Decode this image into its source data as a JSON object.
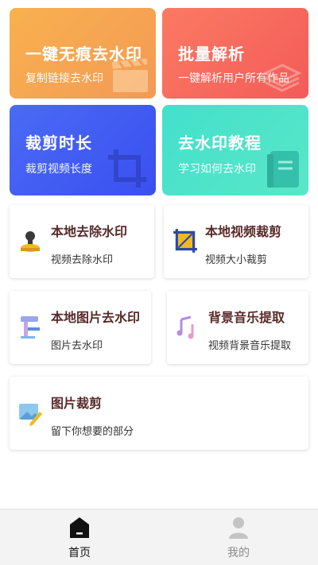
{
  "feature_cards": [
    {
      "title": "一键无痕去水印",
      "subtitle": "复制链接去水印",
      "icon": "clapperboard-icon",
      "colors": [
        "#f9b14f",
        "#f39a55"
      ]
    },
    {
      "title": "批量解析",
      "subtitle": "一键解析用户所有作品",
      "icon": "layers-icon",
      "colors": [
        "#fb7a63",
        "#f35b58"
      ]
    },
    {
      "title": "裁剪时长",
      "subtitle": "裁剪视频长度",
      "icon": "crop-icon",
      "colors": [
        "#4a6bf5",
        "#3a4ff0"
      ]
    },
    {
      "title": "去水印教程",
      "subtitle": "学习如何去水印",
      "icon": "book-icon",
      "colors": [
        "#43e0cc",
        "#59e7c8"
      ]
    }
  ],
  "tool_cards": [
    {
      "title": "本地去除水印",
      "subtitle": "视频去除水印",
      "icon": "stamp-icon"
    },
    {
      "title": "本地视频裁剪",
      "subtitle": "视频大小裁剪",
      "icon": "crop-frame-icon"
    },
    {
      "title": "本地图片去水印",
      "subtitle": "图片去水印",
      "icon": "paint-roller-icon"
    },
    {
      "title": "背景音乐提取",
      "subtitle": "视频背景音乐提取",
      "icon": "music-note-icon"
    },
    {
      "title": "图片裁剪",
      "subtitle": "留下你想要的部分",
      "icon": "image-edit-icon"
    }
  ],
  "bottom_nav": [
    {
      "label": "首页",
      "icon": "home-icon",
      "active": true
    },
    {
      "label": "我的",
      "icon": "user-icon",
      "active": false
    }
  ],
  "colors": {
    "tool_title": "#5a2a2a",
    "nav_active": "#111111",
    "nav_inactive": "#8a8a8a"
  }
}
